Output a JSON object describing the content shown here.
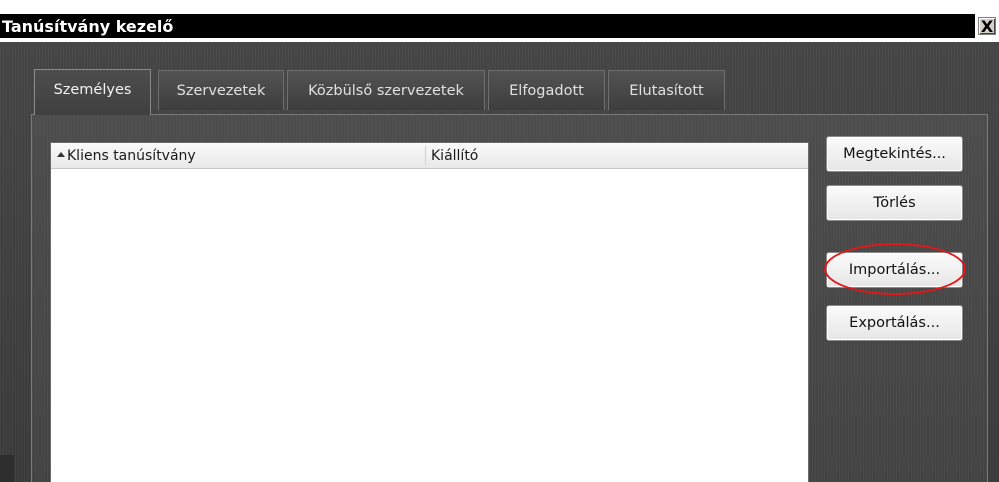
{
  "window": {
    "title": "Tanúsítvány kezelő",
    "close_glyph": "X"
  },
  "tabs": [
    {
      "label": "Személyes",
      "active": true
    },
    {
      "label": "Szervezetek",
      "active": false
    },
    {
      "label": "Közbülső szervezetek",
      "active": false
    },
    {
      "label": "Elfogadott",
      "active": false
    },
    {
      "label": "Elutasított",
      "active": false
    }
  ],
  "list": {
    "columns": [
      {
        "label": "Kliens tanúsítvány",
        "sorted": "ascending"
      },
      {
        "label": "Kiállító"
      }
    ],
    "rows": []
  },
  "buttons": {
    "view": "Megtekintés...",
    "delete": "Törlés",
    "import": "Importálás...",
    "export": "Exportálás..."
  },
  "annotation": {
    "highlight_color": "#e01818",
    "highlighted": "import-button"
  }
}
